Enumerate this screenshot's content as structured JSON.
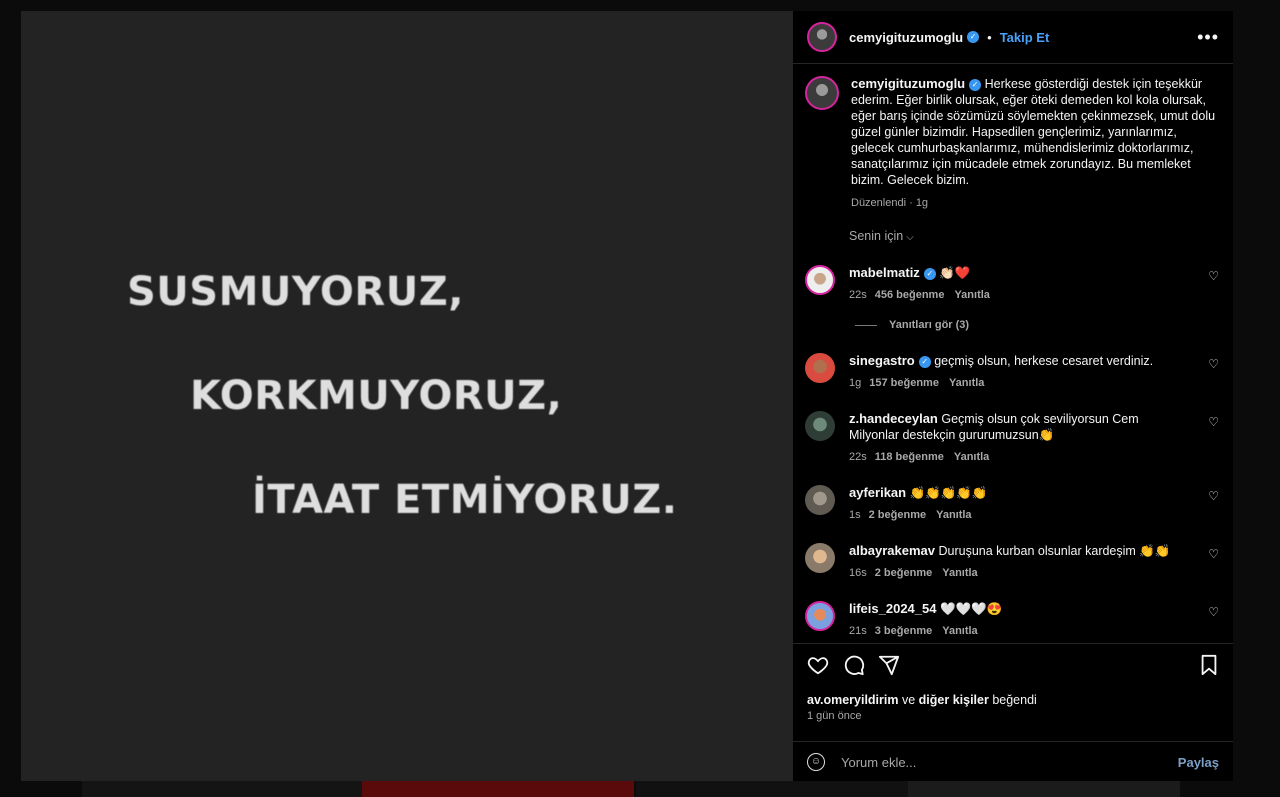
{
  "image_text": {
    "line1": "SUSMUYORUZ,",
    "line2": "KORKMUYORUZ,",
    "line3": "İTAAT ETMİYORUZ."
  },
  "header": {
    "username": "cemyigituzumoglu",
    "dot": "•",
    "follow_label": "Takip Et",
    "more_label": "•••"
  },
  "caption": {
    "username": "cemyigituzumoglu",
    "text": "Herkese gösterdiği destek için teşekkür ederim. Eğer birlik olursak, eğer öteki demeden kol kola olursak, eğer barış içinde sözümüzü söylemekten çekinmezsek, umut dolu güzel günler bizimdir. Hapsedilen gençlerimiz, yarınlarımız, gelecek cumhurbaşkanlarımız, mühendislerimiz doktorlarımız, sanatçılarımız için mücadele etmek zorundayız. Bu memleket bizim. Gelecek bizim.",
    "meta": "Düzenlendi · 1g"
  },
  "sort_label": "Senin için",
  "view_replies": "Yanıtları gör (3)",
  "reply_label": "Yanıtla",
  "comments": [
    {
      "username": "mabelmatiz",
      "verified": true,
      "text": "👏🏻❤️",
      "time": "22s",
      "likes": "456 beğenme"
    },
    {
      "username": "sinegastro",
      "verified": true,
      "text": "geçmiş olsun, herkese cesaret verdiniz.",
      "time": "1g",
      "likes": "157 beğenme"
    },
    {
      "username": "z.handeceylan",
      "verified": false,
      "text": "Geçmiş olsun çok seviliyorsun Cem Milyonlar destekçin gururumuzsun👏",
      "time": "22s",
      "likes": "118 beğenme"
    },
    {
      "username": "ayferikan",
      "verified": false,
      "text": "👏👏👏👏👏",
      "time": "1s",
      "likes": "2 beğenme"
    },
    {
      "username": "albayrakemav",
      "verified": false,
      "text": "Duruşuna kurban olsunlar kardeşim 👏👏",
      "time": "16s",
      "likes": "2 beğenme"
    },
    {
      "username": "lifeis_2024_54",
      "verified": false,
      "text": "🤍🤍🤍😍",
      "time": "21s",
      "likes": "3 beğenme"
    }
  ],
  "likes_line": {
    "user": "av.omeryildirim",
    "middle": "ve",
    "others": "diğer kişiler",
    "suffix": "beğendi"
  },
  "post_time": "1 gün önce",
  "add_comment": {
    "placeholder": "Yorum ekle...",
    "share_label": "Paylaş"
  },
  "colors": {
    "accent": "#4aa1f8",
    "verified": "#3897f0",
    "story_ring": "#d6249f"
  }
}
